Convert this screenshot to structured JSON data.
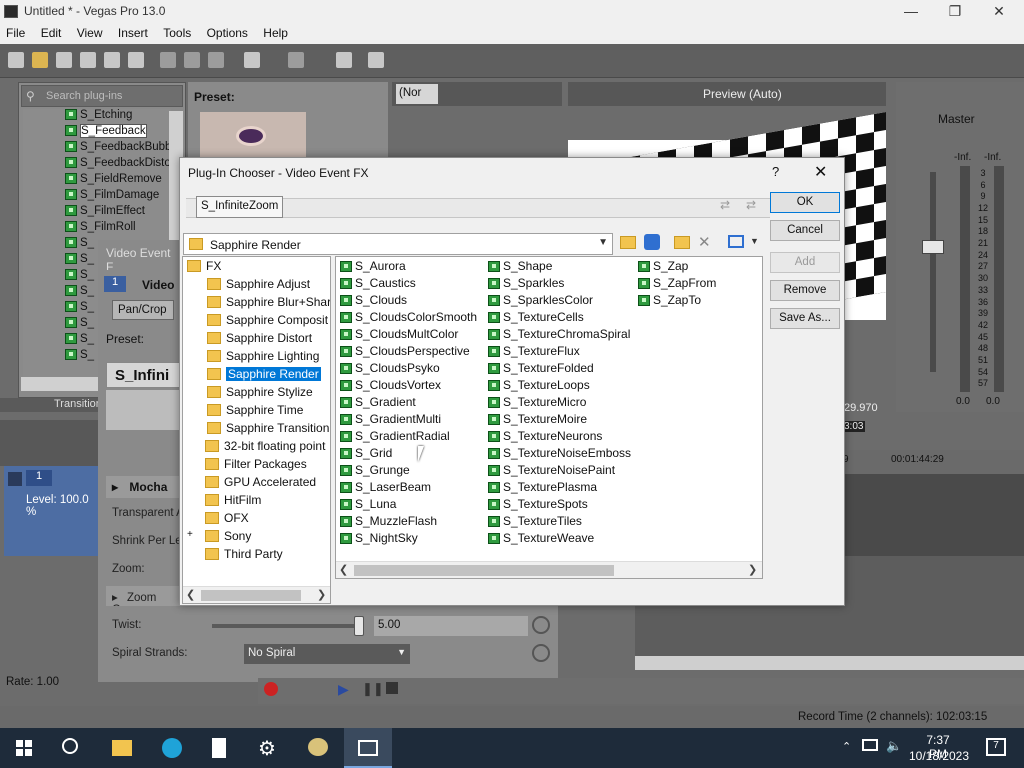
{
  "window": {
    "title": "Untitled * - Vegas Pro 13.0",
    "minimize": "—",
    "maximize": "❐",
    "close": "✕"
  },
  "menu": [
    "File",
    "Edit",
    "View",
    "Insert",
    "Tools",
    "Options",
    "Help"
  ],
  "plugins_panel": {
    "search_placeholder": "Search plug-ins",
    "preset_label": "Preset:",
    "items": [
      "S_Etching",
      "S_Feedback",
      "S_FeedbackBubble",
      "S_FeedbackDistort",
      "S_FieldRemove",
      "S_FilmDamage",
      "S_FilmEffect",
      "S_FilmRoll",
      "S_",
      "S_",
      "S_",
      "S_",
      "S_",
      "S_",
      "S_",
      "S_"
    ],
    "selected_index": 1,
    "tab_label": "Transition"
  },
  "video_event_fx": {
    "title": "Video Event F",
    "track_num": "1",
    "track_label": "Video",
    "chip": "Pan/Crop",
    "preset_label": "Preset:",
    "preset_value": "S_Infini",
    "section_mocha": "Mocha",
    "transparent": "Transparent A",
    "shrink": "Shrink Per Lev",
    "zoom": "Zoom:",
    "zoom_center": "Zoom Cen",
    "twist_label": "Twist:",
    "twist_value": "5.00",
    "spiral_label": "Spiral Strands:",
    "spiral_value": "No Spiral"
  },
  "track": {
    "num": "1",
    "level": "Level: 100.0 %"
  },
  "preview": {
    "zoom_select": "(Nor",
    "preview_mode": "Preview (Auto)",
    "timecode": "29.970",
    "marker": "3:03"
  },
  "master": {
    "title": "Master",
    "inf_left": "-Inf.",
    "inf_right": "-Inf.",
    "scale": [
      "3",
      "6",
      "9",
      "12",
      "15",
      "18",
      "21",
      "24",
      "27",
      "30",
      "33",
      "36",
      "39",
      "42",
      "45",
      "48",
      "51",
      "54",
      "57"
    ],
    "bottom_left": "0.0",
    "bottom_right": "0.0"
  },
  "timeline": {
    "time_left": "9",
    "time_right": "00:01:44:29",
    "rate": "Rate: 1.00",
    "record_time": "Record Time (2 channels): 102:03:15"
  },
  "dialog": {
    "title": "Plug-In Chooser - Video Event FX",
    "help": "?",
    "close": "✕",
    "chain_item": "S_InfiniteZoom",
    "path": "Sapphire Render",
    "buttons": {
      "ok": "OK",
      "cancel": "Cancel",
      "add": "Add",
      "remove": "Remove",
      "save_as": "Save As..."
    },
    "tree": [
      {
        "label": "FX",
        "indent": 0
      },
      {
        "label": "Sapphire Adjust",
        "indent": 1
      },
      {
        "label": "Sapphire Blur+Shar",
        "indent": 1
      },
      {
        "label": "Sapphire Composit",
        "indent": 1
      },
      {
        "label": "Sapphire Distort",
        "indent": 1
      },
      {
        "label": "Sapphire Lighting",
        "indent": 1
      },
      {
        "label": "Sapphire Render",
        "indent": 1,
        "selected": true
      },
      {
        "label": "Sapphire Stylize",
        "indent": 1
      },
      {
        "label": "Sapphire Time",
        "indent": 1
      },
      {
        "label": "Sapphire Transition",
        "indent": 1
      },
      {
        "label": "32-bit floating point",
        "indent": 0.5
      },
      {
        "label": "Filter Packages",
        "indent": 0.5
      },
      {
        "label": "GPU Accelerated",
        "indent": 0.5
      },
      {
        "label": "HitFilm",
        "indent": 0.5
      },
      {
        "label": "OFX",
        "indent": 0.5
      },
      {
        "label": "Sony",
        "indent": 0.5,
        "expander": "+"
      },
      {
        "label": "Third Party",
        "indent": 0.5
      }
    ],
    "columns": [
      [
        "S_Aurora",
        "S_Caustics",
        "S_Clouds",
        "S_CloudsColorSmooth",
        "S_CloudsMultColor",
        "S_CloudsPerspective",
        "S_CloudsPsyko",
        "S_CloudsVortex",
        "S_Gradient",
        "S_GradientMulti",
        "S_GradientRadial",
        "S_Grid",
        "S_Grunge",
        "S_LaserBeam",
        "S_Luna",
        "S_MuzzleFlash",
        "S_NightSky"
      ],
      [
        "S_Shape",
        "S_Sparkles",
        "S_SparklesColor",
        "S_TextureCells",
        "S_TextureChromaSpiral",
        "S_TextureFlux",
        "S_TextureFolded",
        "S_TextureLoops",
        "S_TextureMicro",
        "S_TextureMoire",
        "S_TextureNeurons",
        "S_TextureNoiseEmboss",
        "S_TextureNoisePaint",
        "S_TexturePlasma",
        "S_TextureSpots",
        "S_TextureTiles",
        "S_TextureWeave"
      ],
      [
        "S_Zap",
        "S_ZapFrom",
        "S_ZapTo"
      ]
    ]
  },
  "taskbar": {
    "time": "7:37 PM",
    "date": "10/18/2023",
    "notifications": "7"
  }
}
